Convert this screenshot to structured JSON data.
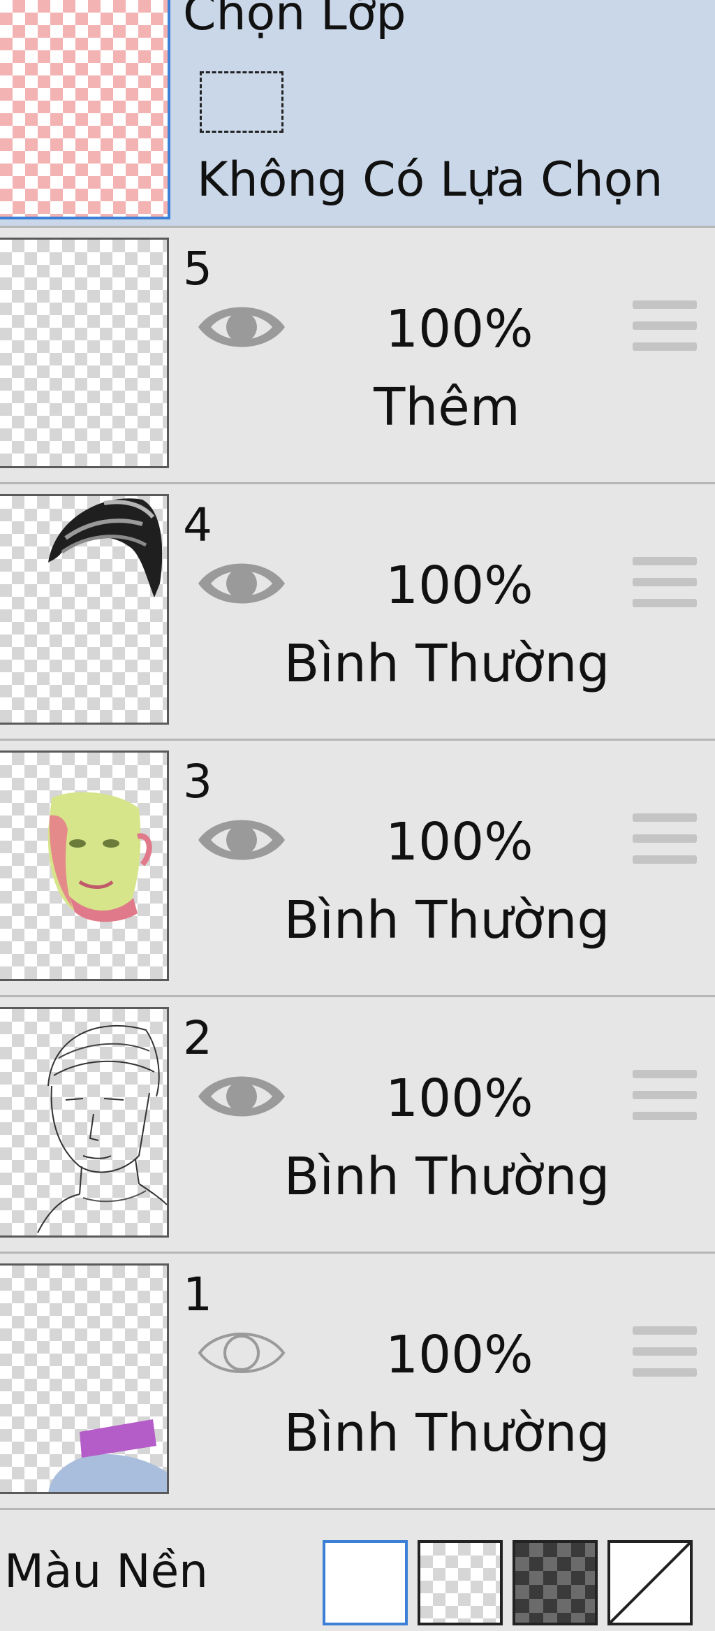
{
  "selection_layer": {
    "title": "Chọn Lớp",
    "status": "Không Có Lựa Chọn",
    "icon": "dashed-selection-rect-icon"
  },
  "layers": [
    {
      "number": "5",
      "opacity": "100%",
      "blend": "Thêm",
      "visible": true
    },
    {
      "number": "4",
      "opacity": "100%",
      "blend": "Bình Thường",
      "visible": true
    },
    {
      "number": "3",
      "opacity": "100%",
      "blend": "Bình Thường",
      "visible": true
    },
    {
      "number": "2",
      "opacity": "100%",
      "blend": "Bình Thường",
      "visible": true
    },
    {
      "number": "1",
      "opacity": "100%",
      "blend": "Bình Thường",
      "visible": false
    }
  ],
  "background": {
    "label": "Màu Nền",
    "options": [
      "white",
      "light-checker",
      "dark-checker",
      "none"
    ],
    "selected": "white"
  },
  "colors": {
    "selection_bg": "#c9d7e8",
    "accent": "#3b7fd6",
    "panel_bg": "#e6e6e6"
  }
}
